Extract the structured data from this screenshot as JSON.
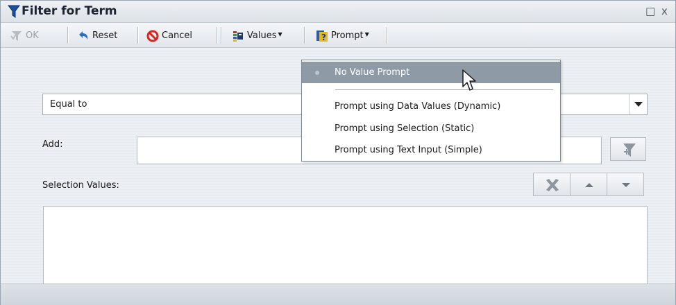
{
  "window": {
    "title": "Filter for Term",
    "maximize_glyph": "□",
    "close_glyph": "x"
  },
  "toolbar": {
    "ok_label": "OK",
    "reset_label": "Reset",
    "cancel_label": "Cancel",
    "values_label": "Values",
    "prompt_label": "Prompt"
  },
  "operator_combo": {
    "selected": "Equal to"
  },
  "add": {
    "label": "Add:",
    "value": ""
  },
  "selection_values": {
    "label": "Selection Values:",
    "items": []
  },
  "prompt_menu": {
    "items": [
      {
        "label": "No Value Prompt",
        "selected": true
      },
      {
        "label": "Prompt using Data Values (Dynamic)"
      },
      {
        "label": "Prompt using Selection (Static)"
      },
      {
        "label": "Prompt using Text Input (Simple)"
      }
    ]
  },
  "icons": {
    "title": "filter-funnel-icon",
    "ok": "filter-check-icon",
    "reset": "undo-arrow-icon",
    "cancel": "cancel-circle-icon",
    "values": "values-bars-icon",
    "prompt": "prompt-question-icon",
    "add_filter": "add-filter-icon",
    "remove": "delete-x-icon",
    "move_up": "arrow-up-icon",
    "move_down": "arrow-down-icon"
  },
  "colors": {
    "menu_highlight": "#8e9aa6",
    "cancel_red": "#d8231f",
    "title_blue": "#1c4f9c"
  }
}
